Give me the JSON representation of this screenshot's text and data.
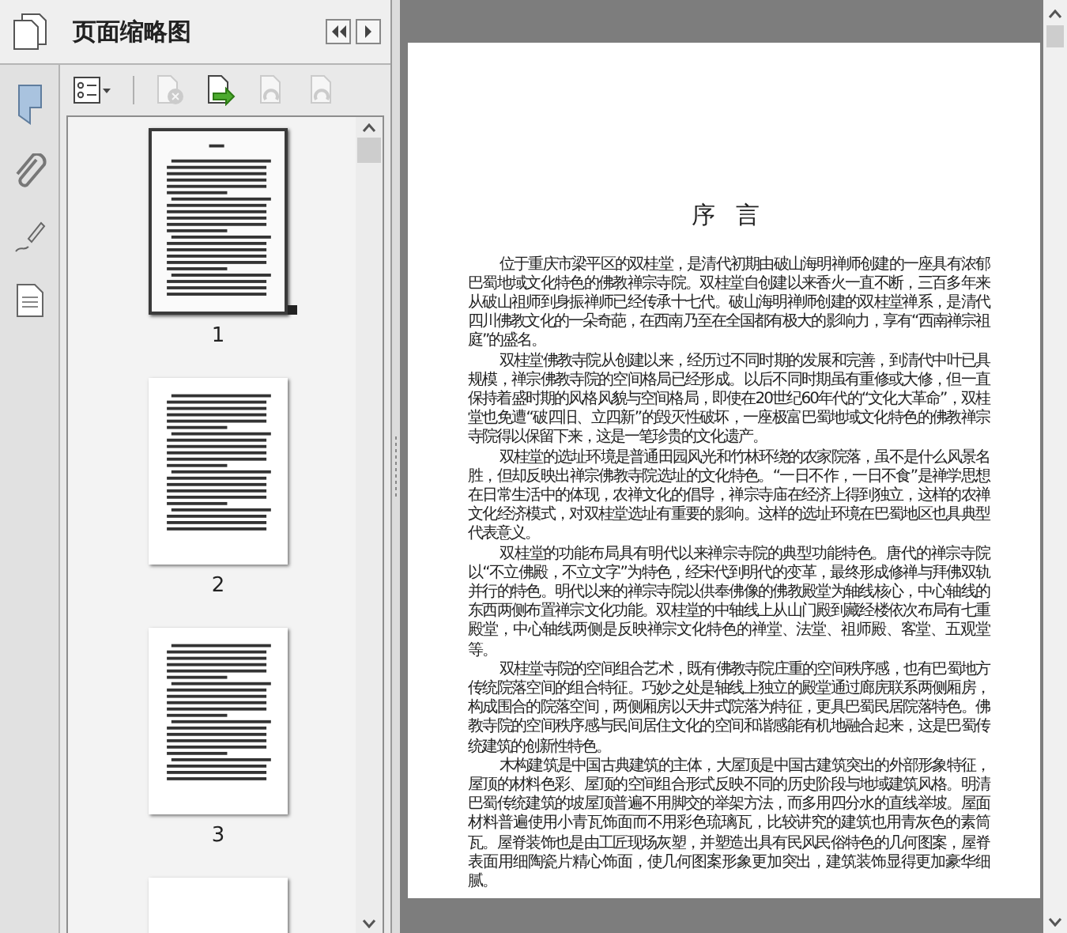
{
  "panel": {
    "title": "页面缩略图"
  },
  "toolbar": [
    {
      "kind": "options",
      "disabled": false
    },
    {
      "kind": "delete",
      "disabled": true
    },
    {
      "kind": "insert",
      "disabled": false
    },
    {
      "kind": "rotate",
      "disabled": true
    },
    {
      "kind": "rotate",
      "disabled": true
    }
  ],
  "thumbnails": [
    {
      "label": "1",
      "selected": true
    },
    {
      "label": "2",
      "selected": false
    },
    {
      "label": "3",
      "selected": false
    },
    {
      "selected": false
    }
  ],
  "document": {
    "heading": "序 言",
    "paragraphs": [
      "位于重庆市梁平区的双桂堂，是清代初期由破山海明禅师创建的一座具有浓郁巴蜀地域文化特色的佛教禅宗寺院。双桂堂自创建以来香火一直不断，三百多年来从破山祖师到身振禅师已经传承十七代。破山海明禅师创建的双桂堂禅系，是清代四川佛教文化的一朵奇葩，在西南乃至在全国都有极大的影响力，享有“西南禅宗祖庭”的盛名。",
      "双桂堂佛教寺院从创建以来，经历过不同时期的发展和完善，到清代中叶已具规模，禅宗佛教寺院的空间格局已经形成。以后不同时期虽有重修或大修，但一直保持着盛时期的风格风貌与空间格局，即使在20世纪60年代的“文化大革命”，双桂堂也免遭“破四旧、立四新”的毁灭性破坏，一座极富巴蜀地域文化特色的佛教禅宗寺院得以保留下来，这是一笔珍贵的文化遗产。",
      "双桂堂的选址环境是普通田园风光和竹林环绕的农家院落，虽不是什么风景名胜，但却反映出禅宗佛教寺院选址的文化特色。“一日不作，一日不食”是禅学思想在日常生活中的体现，农禅文化的倡导，禅宗寺庙在经济上得到独立，这样的农禅文化经济模式，对双桂堂选址有重要的影响。这样的选址环境在巴蜀地区也具典型代表意义。",
      "双桂堂的功能布局具有明代以来禅宗寺院的典型功能特色。唐代的禅宗寺院以“不立佛殿，不立文字”为特色，经宋代到明代的变革，最终形成修禅与拜佛双轨并行的特色。明代以来的禅宗寺院以供奉佛像的佛教殿堂为轴线核心，中心轴线的东西两侧布置禅宗文化功能。双桂堂的中轴线上从山门殿到藏经楼依次布局有七重殿堂，中心轴线两侧是反映禅宗文化特色的禅堂、法堂、祖师殿、客堂、五观堂等。",
      "双桂堂寺院的空间组合艺术，既有佛教寺院庄重的空间秩序感，也有巴蜀地方传统院落空间的组合特征。巧妙之处是轴线上独立的殿堂通过廊庑联系两侧厢房，构成围合的院落空间，两侧厢房以天井式院落为特征，更具巴蜀民居院落特色。佛教寺院的空间秩序感与民间居住文化的空间和谐感能有机地融合起来，这是巴蜀传统建筑的创新性特色。",
      "木构建筑是中国古典建筑的主体，大屋顶是中国古建筑突出的外部形象特征，屋顶的材料色彩、屋顶的空间组合形式反映不同的历史阶段与地域建筑风格。明清巴蜀传统建筑的坡屋顶普遍不用脚交的举架方法，而多用四分水的直线举坡。屋面材料普遍使用小青瓦饰面而不用彩色琉璃瓦，比较讲究的建筑也用青灰色的素筒瓦。屋脊装饰也是由工匠现场灰塑，并塑造出具有民风民俗特色的几何图案，屋脊表面用细陶瓷片精心饰面，使几何图案形象更加突出，建筑装饰显得更加豪华细腻。"
    ]
  }
}
